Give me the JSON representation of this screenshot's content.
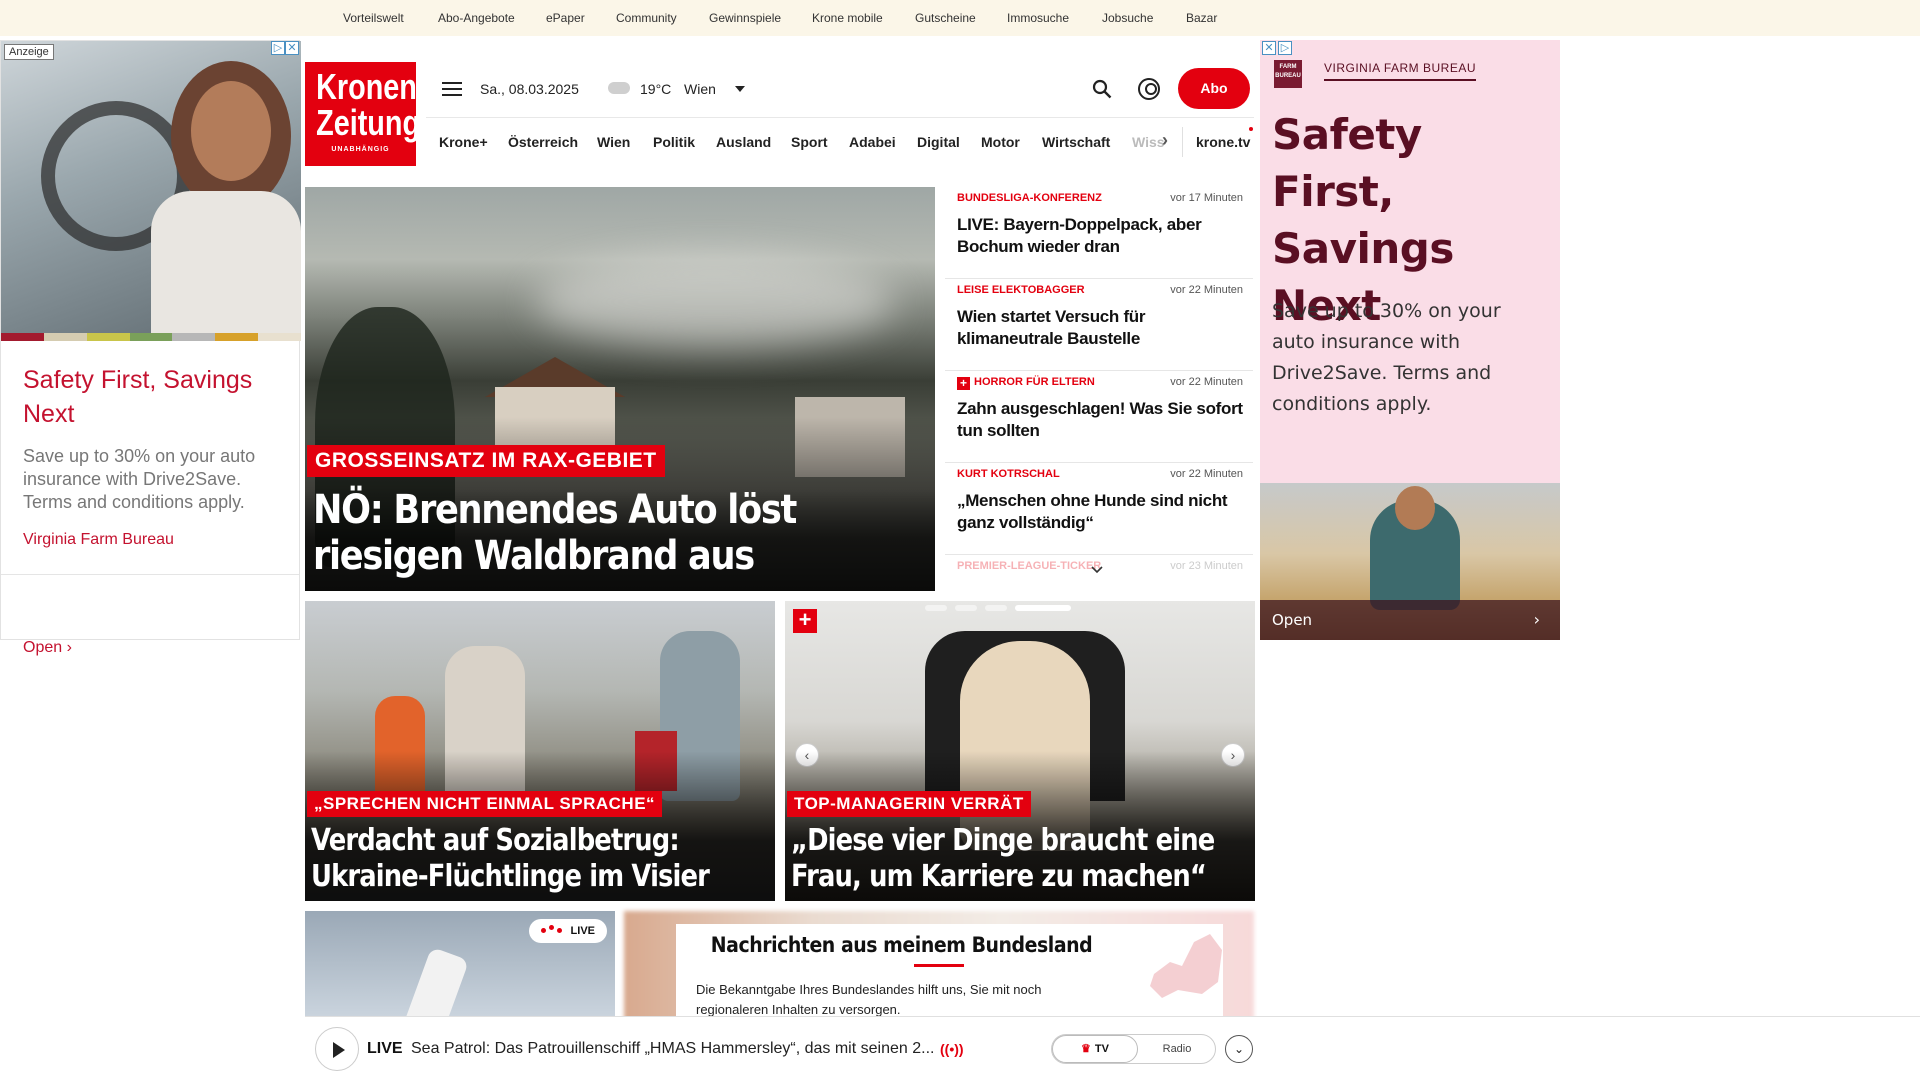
{
  "topbar": {
    "links": [
      "Vorteilswelt",
      "Abo-Angebote",
      "ePaper",
      "Community",
      "Gewinnspiele",
      "Krone mobile",
      "Gutscheine",
      "Immosuche",
      "Jobsuche",
      "Bazar"
    ]
  },
  "ad_left": {
    "label": "Anzeige",
    "headline": "Safety First, Savings Next",
    "body": "Save up to 30% on your auto insurance with Drive2Save. Terms and conditions apply.",
    "brand": "Virginia Farm Bureau",
    "cta": "Open",
    "strip_colors": [
      "#a31a2e",
      "#d5ccb1",
      "#c9c54a",
      "#7aa05a",
      "#b7b7b7",
      "#d7a12a",
      "#e8e0cf"
    ]
  },
  "header": {
    "logo_line1": "Kronen",
    "logo_line2": "Zeitung",
    "logo_line3": "UNABHÄNGIG",
    "date": "Sa., 08.03.2025",
    "temperature": "19°C",
    "location": "Wien",
    "abo_label": "Abo",
    "nav": [
      "Krone+",
      "Österreich",
      "Wien",
      "Politik",
      "Ausland",
      "Sport",
      "Adabei",
      "Digital",
      "Motor",
      "Wirtschaft",
      "Wiss"
    ],
    "nav_right": "krone.tv",
    "accent_color": "#e3000f"
  },
  "hero": {
    "kicker": "GROSSEINSATZ IM RAX-GEBIET",
    "title": "NÖ: Brennendes Auto löst riesigen Waldbrand aus"
  },
  "ticker": [
    {
      "category": "BUNDESLIGA-KONFERENZ",
      "time": "vor 17 Minuten",
      "title": "LIVE: Bayern-Doppelpack, aber Bochum wieder dran",
      "plus": false
    },
    {
      "category": "LEISE ELEKTOBAGGER",
      "time": "vor 22 Minuten",
      "title": "Wien startet Versuch für klimaneutrale Baustelle",
      "plus": false
    },
    {
      "category": "HORROR FÜR ELTERN",
      "time": "vor 22 Minuten",
      "title": "Zahn ausgeschlagen! Was Sie sofort tun sollten",
      "plus": true
    },
    {
      "category": "KURT KOTRSCHAL",
      "time": "vor 22 Minuten",
      "title": "„Menschen ohne Hunde sind nicht ganz vollständig“",
      "plus": false
    },
    {
      "category": "PREMIER-LEAGUE-TICKER",
      "time": "vor 23 Minuten",
      "title": "",
      "plus": false
    }
  ],
  "cards": [
    {
      "kicker": "„SPRECHEN NICHT EINMAL SPRACHE“",
      "title_line1": "Verdacht auf Sozialbetrug:",
      "title_line2": "Ukraine-Flüchtlinge im Visier"
    },
    {
      "kicker": "TOP-MANAGERIN VERRÄT",
      "title_line1": "„Diese vier Dinge braucht eine",
      "title_line2": "Frau, um Karriere zu machen“"
    }
  ],
  "live_card": {
    "badge": "LIVE"
  },
  "bundesland": {
    "title": "Nachrichten aus meinem Bundesland",
    "text": "Die Bekanntgabe Ihres Bundeslandes hilft uns, Sie mit noch regionaleren Inhalten zu versorgen."
  },
  "player": {
    "live_label": "LIVE",
    "now_playing": "Sea Patrol: Das Patrouillenschiff „HMAS Hammersley“, das mit seinen 2...",
    "broadcast_icon": "((•))",
    "tv_label": "TV",
    "radio_label": "Radio"
  },
  "ad_right": {
    "logo_text": "FARM BUREAU",
    "brand": "VIRGINIA FARM BUREAU",
    "headline": "Safety First, Savings Next",
    "body": "Save up to 30% on your auto insurance with Drive2Save. Terms and conditions apply.",
    "cta": "Open"
  }
}
